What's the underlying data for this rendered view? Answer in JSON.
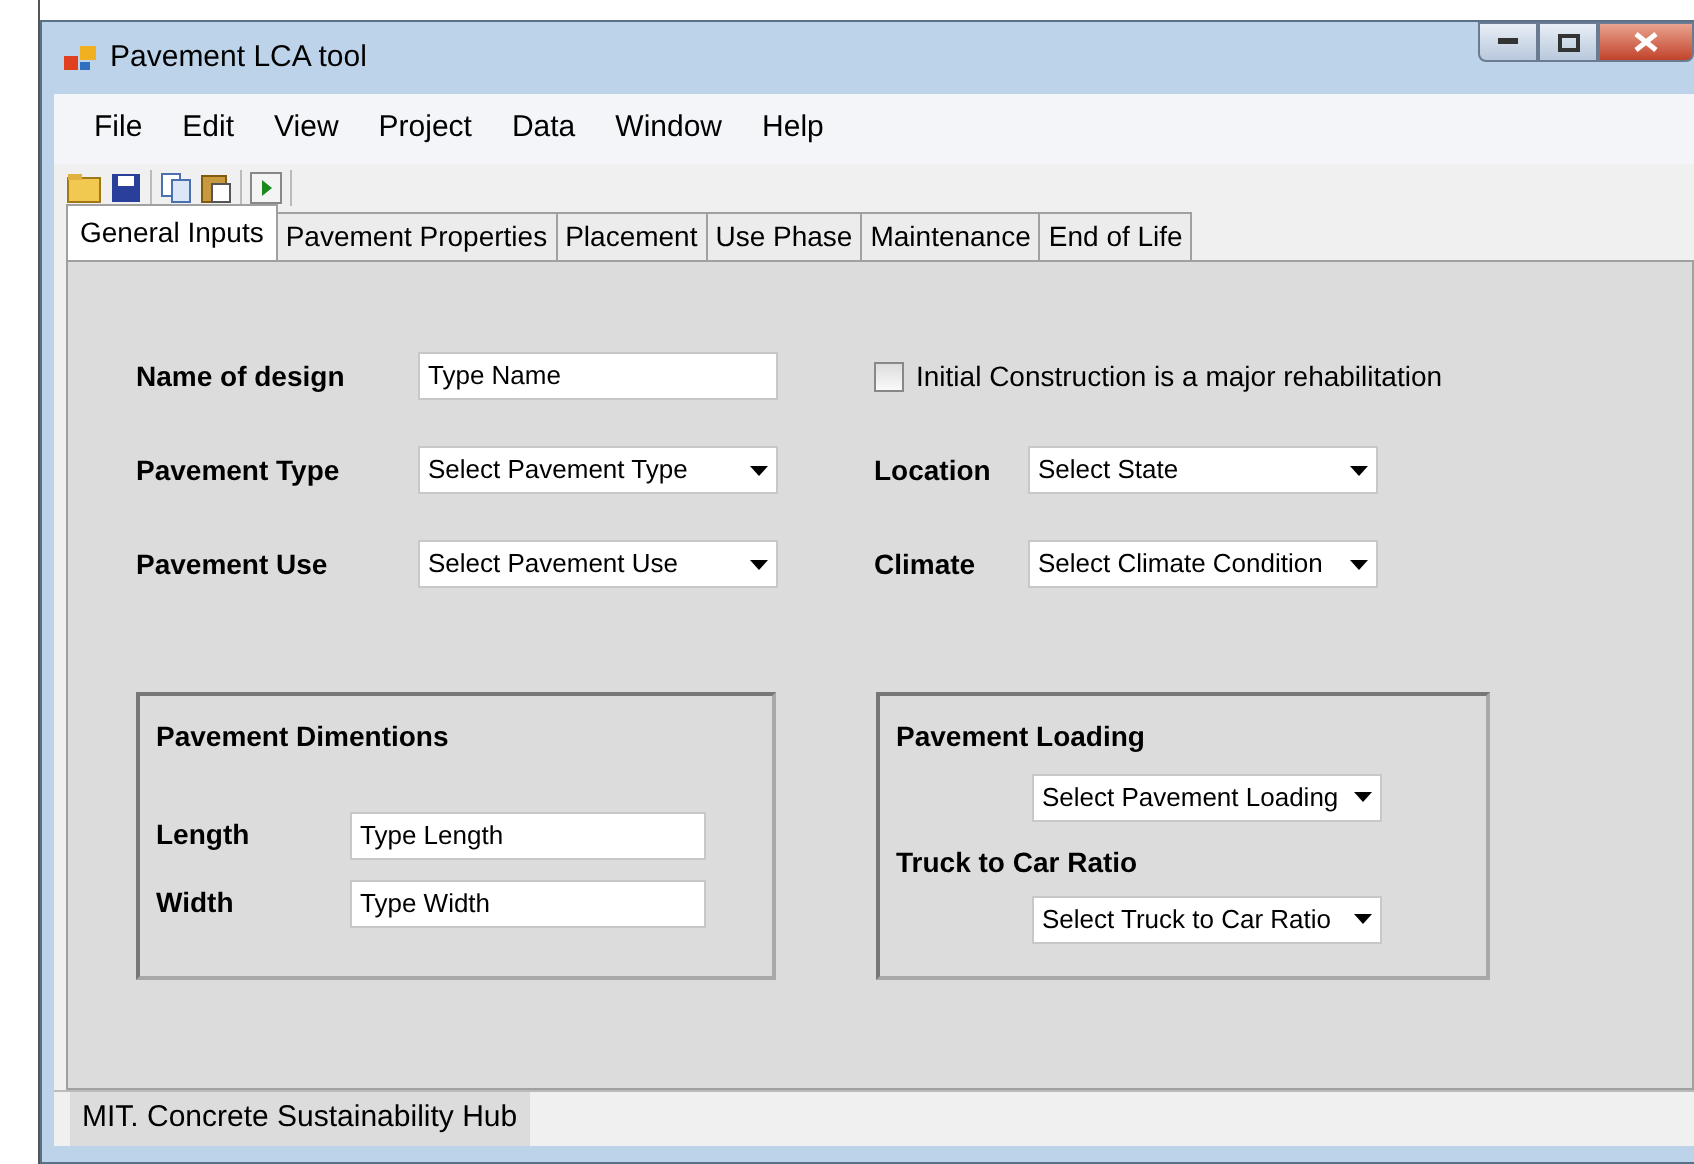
{
  "window": {
    "title": "Pavement LCA tool"
  },
  "menu": [
    "File",
    "Edit",
    "View",
    "Project",
    "Data",
    "Window",
    "Help"
  ],
  "tabs": [
    {
      "label": "General Inputs",
      "selected": true
    },
    {
      "label": "Pavement Properties",
      "selected": false
    },
    {
      "label": "Placement",
      "selected": false
    },
    {
      "label": "Use Phase",
      "selected": false
    },
    {
      "label": "Maintenance",
      "selected": false
    },
    {
      "label": "End of Life",
      "selected": false
    }
  ],
  "name_of_design": {
    "label": "Name of design",
    "value": "Type Name"
  },
  "major_rehabilitation": {
    "label": "Initial Construction is a major rehabilitation",
    "checked": false
  },
  "pavement_type": {
    "label": "Pavement Type",
    "value": "Select Pavement Type"
  },
  "location": {
    "label": "Location",
    "value": "Select State"
  },
  "pavement_use": {
    "label": "Pavement Use",
    "value": "Select Pavement Use"
  },
  "climate": {
    "label": "Climate",
    "value": "Select Climate Condition"
  },
  "pavement_dimensions": {
    "title": "Pavement Dimentions",
    "fields": [
      {
        "label": "Length",
        "value": "Type Length"
      },
      {
        "label": "Width",
        "value": "Type Width"
      }
    ]
  },
  "pavement_loading": {
    "title": "Pavement Loading",
    "value": "Select Pavement Loading"
  },
  "truck_to_car_ratio": {
    "title": "Truck to Car Ratio",
    "value": "Select Truck to Car Ratio"
  },
  "status_bar": "MIT. Concrete Sustainability Hub"
}
